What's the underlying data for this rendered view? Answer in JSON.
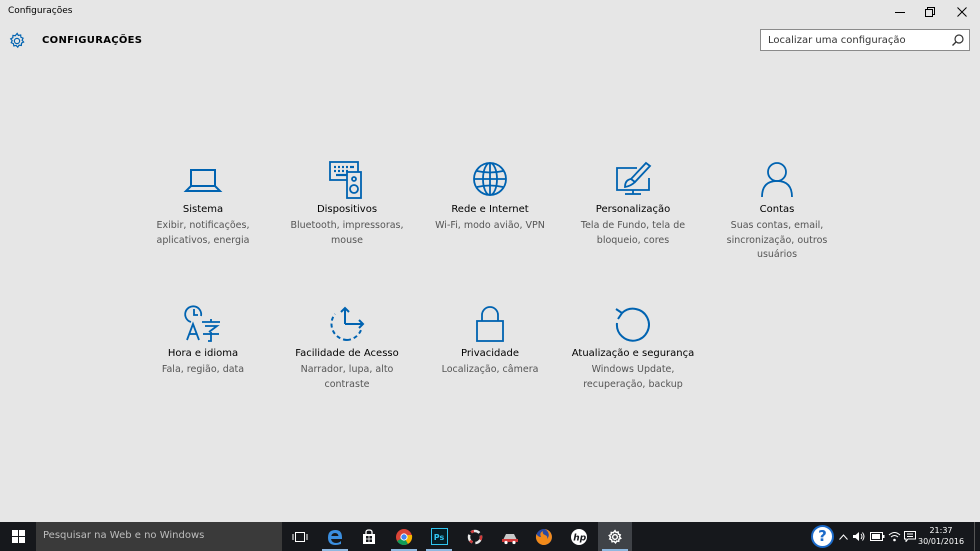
{
  "window": {
    "title": "Configurações",
    "minimize_icon": "minimize-icon",
    "maximize_icon": "restore-icon",
    "close_icon": "close-icon"
  },
  "header": {
    "title": "CONFIGURAÇÕES",
    "icon": "gear-icon",
    "search_placeholder": "Localizar uma configuração",
    "search_value": ""
  },
  "accent_color": "#0063b1",
  "tiles": [
    {
      "name": "Sistema",
      "desc": "Exibir, notificações, aplicativos, energia",
      "icon": "laptop-icon"
    },
    {
      "name": "Dispositivos",
      "desc": "Bluetooth, impressoras, mouse",
      "icon": "devices-icon"
    },
    {
      "name": "Rede e Internet",
      "desc": "Wi-Fi, modo avião, VPN",
      "icon": "globe-icon"
    },
    {
      "name": "Personalização",
      "desc": "Tela de Fundo, tela de bloqueio, cores",
      "icon": "paint-icon"
    },
    {
      "name": "Contas",
      "desc": "Suas contas, email, sincronização, outros usuários",
      "icon": "person-icon"
    },
    {
      "name": "Hora e idioma",
      "desc": "Fala, região, data",
      "icon": "time-language-icon"
    },
    {
      "name": "Facilidade de Acesso",
      "desc": "Narrador, lupa, alto contraste",
      "icon": "ease-of-access-icon"
    },
    {
      "name": "Privacidade",
      "desc": "Localização, câmera",
      "icon": "lock-icon"
    },
    {
      "name": "Atualização e segurança",
      "desc": "Windows Update, recuperação, backup",
      "icon": "update-icon"
    }
  ],
  "taskbar": {
    "search_placeholder": "Pesquisar na Web e no Windows",
    "time": "21:37",
    "date": "30/01/2016",
    "help_label": "?"
  }
}
